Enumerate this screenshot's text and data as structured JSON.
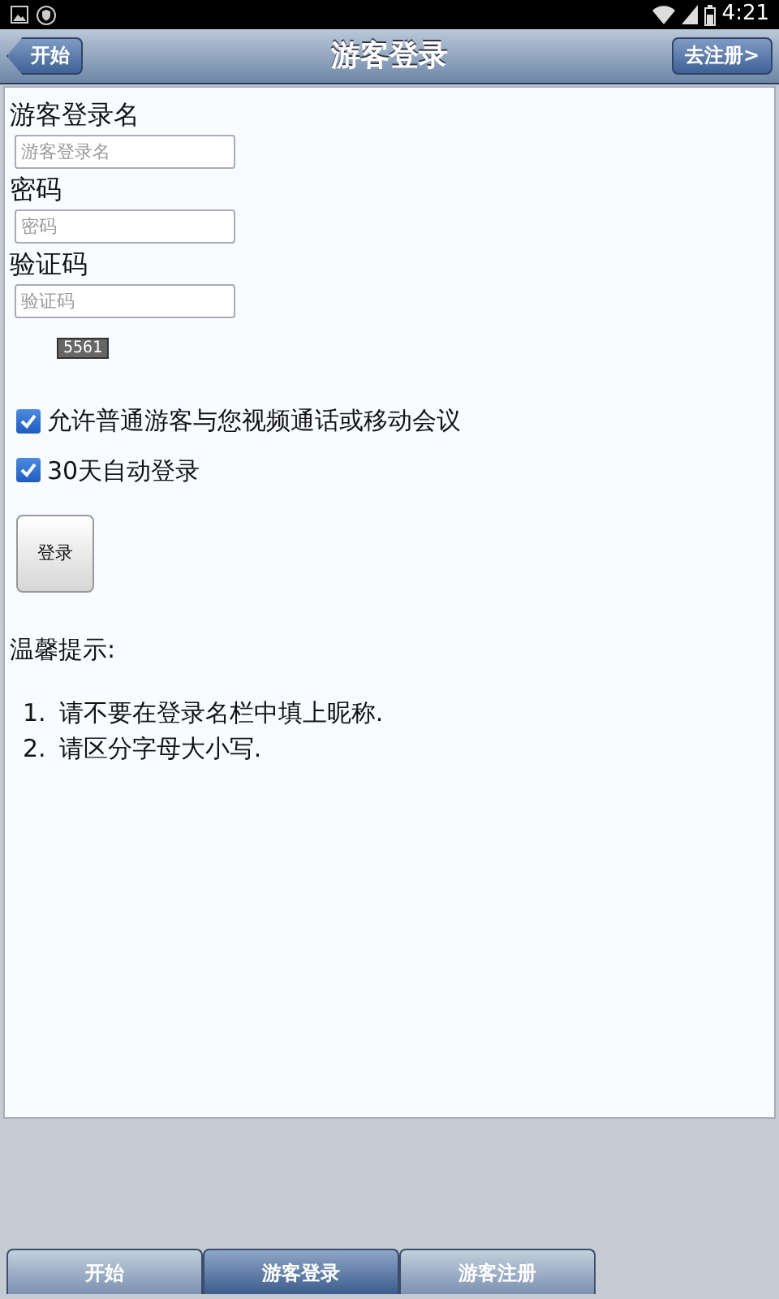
{
  "status_bar": {
    "time": "4:21"
  },
  "header": {
    "back_button": "开始",
    "title": "游客登录",
    "action_button": "去注册>"
  },
  "form": {
    "fields": [
      {
        "label": "游客登录名",
        "placeholder": "游客登录名"
      },
      {
        "label": "密码",
        "placeholder": "密码"
      },
      {
        "label": "验证码",
        "placeholder": "验证码"
      }
    ],
    "captcha": "5561",
    "options": [
      {
        "label": "允许普通游客与您视频通话或移动会议",
        "checked": true
      },
      {
        "label": "30天自动登录",
        "checked": true
      }
    ],
    "submit": "登录"
  },
  "tips": {
    "title": "温馨提示:",
    "items": [
      {
        "number": "1.",
        "text": "请不要在登录名栏中填上昵称."
      },
      {
        "number": "2.",
        "text": "请区分字母大小写."
      }
    ]
  },
  "tabs": [
    {
      "label": "开始",
      "selected": false
    },
    {
      "label": "游客登录",
      "selected": true
    },
    {
      "label": "游客注册",
      "selected": false
    }
  ]
}
